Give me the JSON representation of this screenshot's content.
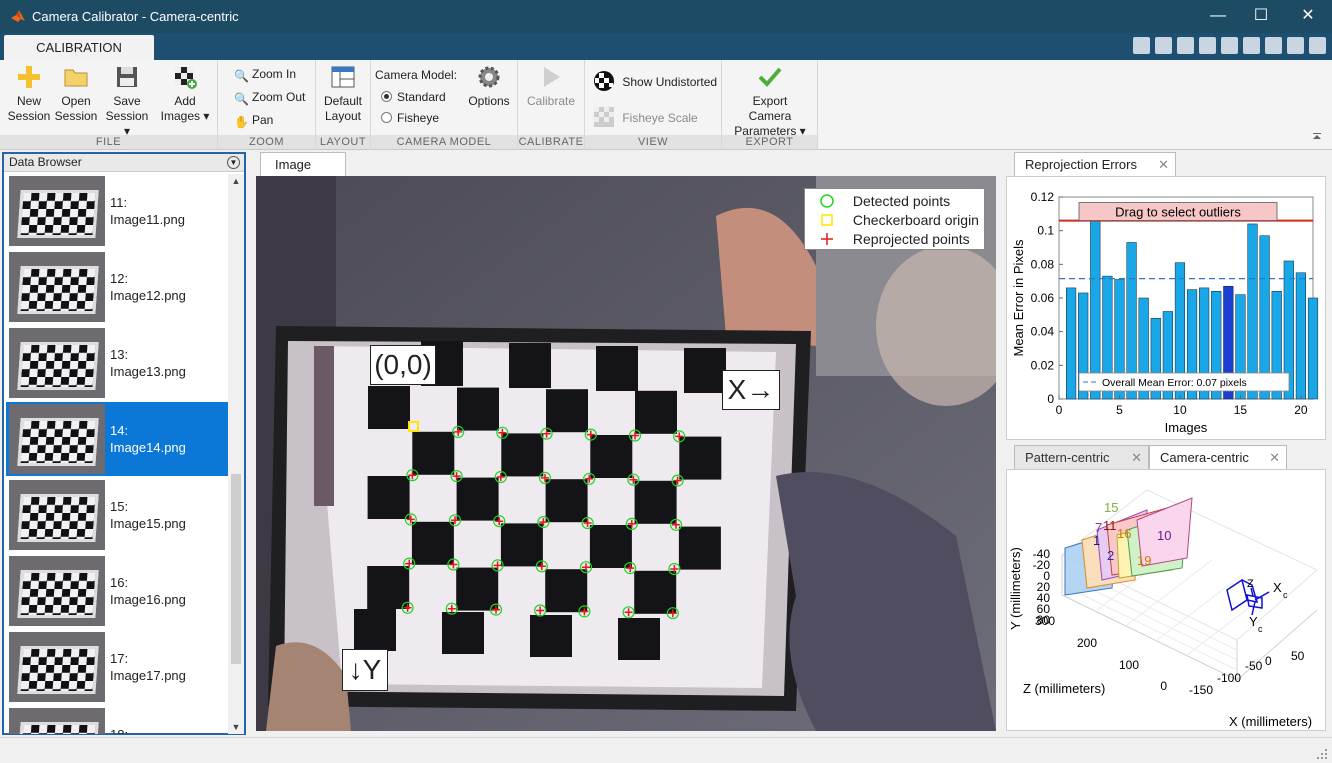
{
  "window": {
    "title": "Camera Calibrator - Camera-centric",
    "minimize": "—",
    "maximize": "☐",
    "close": "✕"
  },
  "tabstrip": {
    "active_tab": "CALIBRATION"
  },
  "toolstrip": {
    "file": {
      "label": "FILE",
      "new_session_1": "New",
      "new_session_2": "Session",
      "open_session_1": "Open",
      "open_session_2": "Session",
      "save_session_1": "Save",
      "save_session_2": "Session ▾",
      "add_images_1": "Add",
      "add_images_2": "Images ▾"
    },
    "zoom": {
      "label": "ZOOM",
      "zoom_in": "Zoom In",
      "zoom_out": "Zoom Out",
      "pan": "Pan"
    },
    "layout": {
      "label": "LAYOUT",
      "default_layout_1": "Default",
      "default_layout_2": "Layout"
    },
    "camera_model": {
      "label": "CAMERA MODEL",
      "title": "Camera Model:",
      "standard": "Standard",
      "fisheye": "Fisheye",
      "options": "Options",
      "selected": "Standard"
    },
    "calibrate": {
      "label": "CALIBRATE",
      "calibrate": "Calibrate"
    },
    "view": {
      "label": "VIEW",
      "show_undistorted": "Show Undistorted",
      "fisheye_scale": "Fisheye Scale"
    },
    "export": {
      "label": "EXPORT",
      "export_1": "Export Camera",
      "export_2": "Parameters ▾"
    }
  },
  "data_browser": {
    "title": "Data Browser",
    "items": [
      {
        "num": "11:",
        "name": "Image11.png",
        "selected": false
      },
      {
        "num": "12:",
        "name": "Image12.png",
        "selected": false
      },
      {
        "num": "13:",
        "name": "Image13.png",
        "selected": false
      },
      {
        "num": "14:",
        "name": "Image14.png",
        "selected": true
      },
      {
        "num": "15:",
        "name": "Image15.png",
        "selected": false
      },
      {
        "num": "16:",
        "name": "Image16.png",
        "selected": false
      },
      {
        "num": "17:",
        "name": "Image17.png",
        "selected": false
      },
      {
        "num": "18:",
        "name": "",
        "selected": false
      }
    ]
  },
  "image_panel": {
    "tab": "Image",
    "legend": {
      "detected": "Detected points",
      "origin": "Checkerboard origin",
      "reprojected": "Reprojected points"
    },
    "origin_label": "(0,0)",
    "x_label": "X→",
    "y_label": "↓Y"
  },
  "reprojection": {
    "tab": "Reprojection Errors",
    "close": "✕",
    "outlier_label": "Drag to select outliers",
    "mean_label": "Overall Mean Error: 0.07 pixels",
    "colors": {
      "bar": "#1aa7e8",
      "selected_bar": "#1a3fd1",
      "threshold": "#d9261c",
      "outlier_box": "#f7c6c6"
    },
    "chart_data": {
      "type": "bar",
      "xlabel": "Images",
      "ylabel": "Mean Error in Pixels",
      "ylim": [
        0,
        0.12
      ],
      "xlim": [
        0,
        21
      ],
      "yticks": [
        "0",
        "0.02",
        "0.04",
        "0.06",
        "0.08",
        "0.1",
        "0.12"
      ],
      "xticks": [
        "0",
        "5",
        "10",
        "15",
        "20"
      ],
      "categories": [
        1,
        2,
        3,
        4,
        5,
        6,
        7,
        8,
        9,
        10,
        11,
        12,
        13,
        14,
        15,
        16,
        17,
        18,
        19,
        20
      ],
      "values": [
        0.066,
        0.063,
        0.106,
        0.073,
        0.071,
        0.093,
        0.06,
        0.048,
        0.052,
        0.081,
        0.065,
        0.066,
        0.064,
        0.067,
        0.062,
        0.104,
        0.097,
        0.064,
        0.082,
        0.075,
        0.06
      ],
      "mean": 0.0715,
      "threshold": 0.106,
      "selected_index": 14
    }
  },
  "camera_centric": {
    "tab_pattern": "Pattern-centric",
    "tab_camera": "Camera-centric",
    "close": "✕",
    "y_axis": "Y (millimeters)",
    "z_axis": "Z (millimeters)",
    "x_axis": "X (millimeters)",
    "y_ticks": [
      "-40",
      "-20",
      "0",
      "20",
      "40",
      "60",
      "80"
    ],
    "z_ticks": [
      "300",
      "200",
      "100",
      "0"
    ],
    "x_ticks": [
      "-150",
      "-100",
      "-50",
      "0",
      "50"
    ],
    "labels": {
      "xc": "X",
      "yc": "Y",
      "zc": "Z",
      "sub": "c"
    },
    "board_labels": [
      "15",
      "1",
      "11",
      "7",
      "16",
      "2",
      "19",
      "10"
    ]
  }
}
